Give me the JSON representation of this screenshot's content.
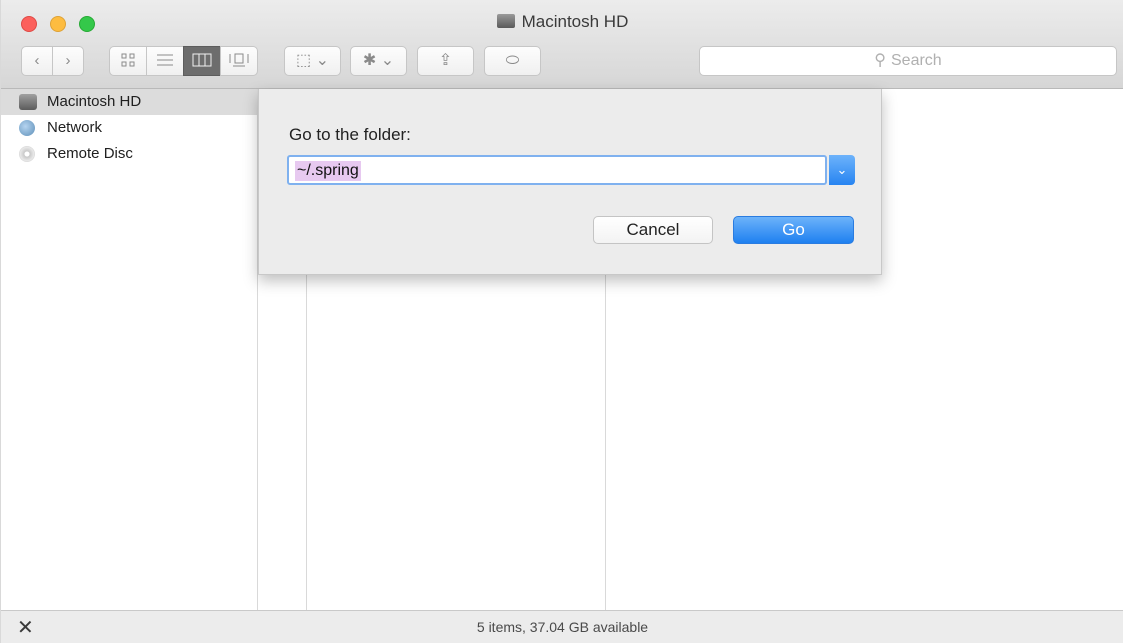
{
  "window": {
    "title": "Macintosh HD"
  },
  "toolbar": {
    "back_glyph": "‹",
    "forward_glyph": "›",
    "view_icons": [
      "icon-view-icon",
      "list-view-icon",
      "column-view-icon",
      "gallery-view-icon"
    ],
    "active_view": "column-view-icon",
    "arrange_glyph": "⬚ ⌄",
    "action_glyph": "✱ ⌄",
    "share_glyph": "⇪",
    "tags_glyph": "⬭"
  },
  "search": {
    "placeholder": "Search",
    "icon": "magnifier-icon"
  },
  "sidebar": {
    "items": [
      {
        "label": "Macintosh HD",
        "icon": "hard-drive-icon",
        "selected": true
      },
      {
        "label": "Network",
        "icon": "network-globe-icon",
        "selected": false
      },
      {
        "label": "Remote Disc",
        "icon": "remote-disc-icon",
        "selected": false
      }
    ]
  },
  "dialog": {
    "prompt": "Go to the folder:",
    "path_value": "~/.spring",
    "cancel_label": "Cancel",
    "go_label": "Go",
    "dropdown_glyph": "⌄"
  },
  "statusbar": {
    "text": "5 items, 37.04 GB available",
    "icon_glyph": "✕"
  },
  "colors": {
    "accent": "#2784f1",
    "selection_highlight": "#e7c9f0",
    "close": "#fc605c",
    "minimize": "#fdbc40",
    "maximize": "#34c84a"
  }
}
